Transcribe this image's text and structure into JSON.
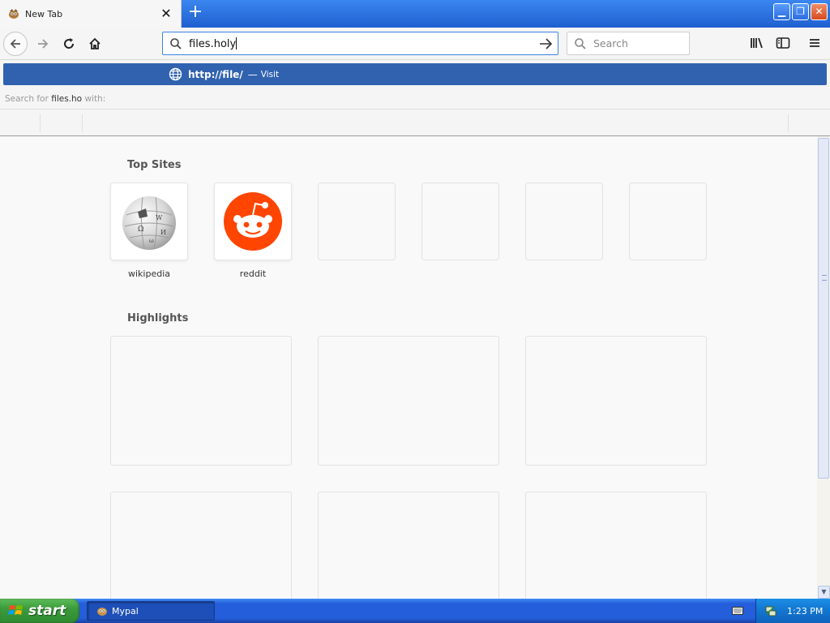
{
  "browser": {
    "tab_title": "New Tab",
    "url_value": "files.holy",
    "search_placeholder": "Search"
  },
  "autocomplete": {
    "suggestion_prefix": "http://",
    "suggestion_bold": "file",
    "suggestion_suffix": "/",
    "dash": "—",
    "action": "Visit",
    "search_for_prefix": "Search for",
    "search_for_query": "files.ho",
    "search_for_suffix": "with:"
  },
  "newtab": {
    "top_sites_title": "Top Sites",
    "top_sites": [
      {
        "label": "wikipedia",
        "icon": "wikipedia-globe-icon"
      },
      {
        "label": "reddit",
        "icon": "reddit-alien-icon"
      },
      {
        "label": ""
      },
      {
        "label": ""
      },
      {
        "label": ""
      },
      {
        "label": ""
      }
    ],
    "highlights_title": "Highlights"
  },
  "taskbar": {
    "start_label": "start",
    "task_label": "Mypal",
    "clock": "1:23 PM"
  },
  "colors": {
    "suggestion_bg": "#3062b0",
    "reddit_orange": "#ff4500",
    "xp_blue": "#245edb",
    "start_green": "#3c9b3c"
  }
}
